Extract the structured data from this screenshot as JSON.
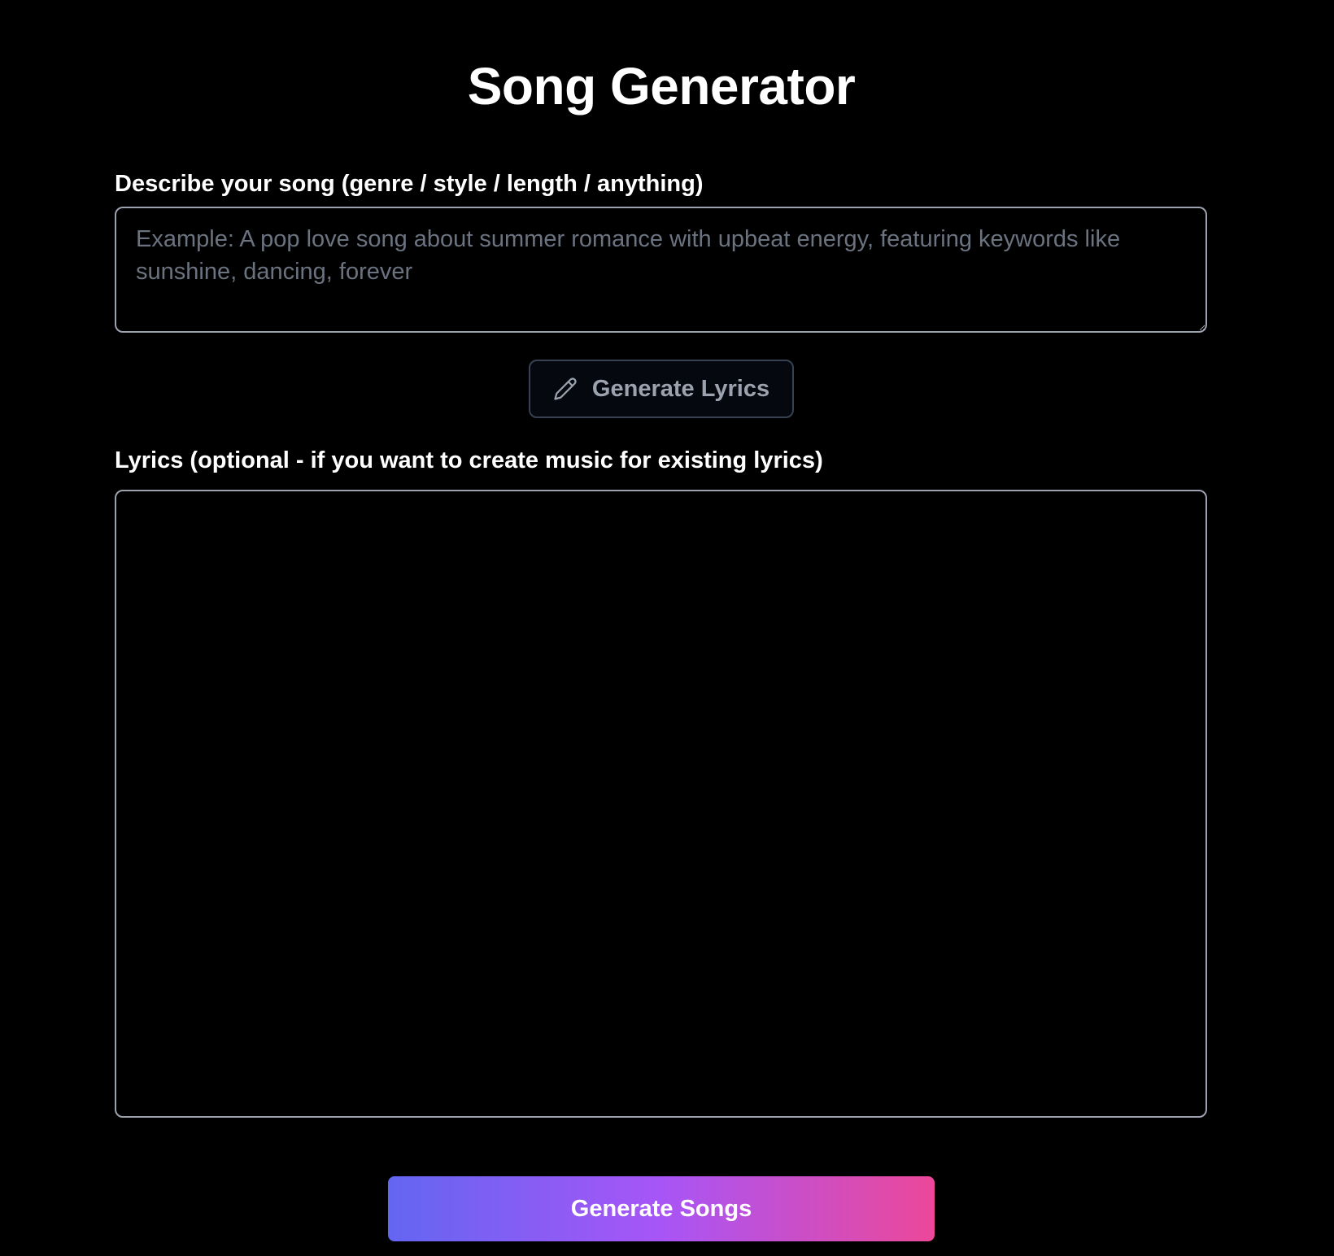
{
  "page": {
    "title": "Song Generator"
  },
  "describe": {
    "label": "Describe your song (genre / style / length / anything)",
    "placeholder": "Example: A pop love song about summer romance with upbeat energy, featuring keywords like sunshine, dancing, forever",
    "value": ""
  },
  "generate_lyrics": {
    "label": "Generate Lyrics",
    "icon": "pencil-icon"
  },
  "lyrics": {
    "label": "Lyrics (optional - if you want to create music for existing lyrics)",
    "placeholder": "",
    "value": ""
  },
  "generate_songs": {
    "label": "Generate Songs"
  },
  "colors": {
    "background": "#000000",
    "border": "#9ca3af",
    "placeholder": "#6b7280",
    "button_gradient_start": "#6366f1",
    "button_gradient_mid": "#a855f7",
    "button_gradient_end": "#ec4899"
  }
}
